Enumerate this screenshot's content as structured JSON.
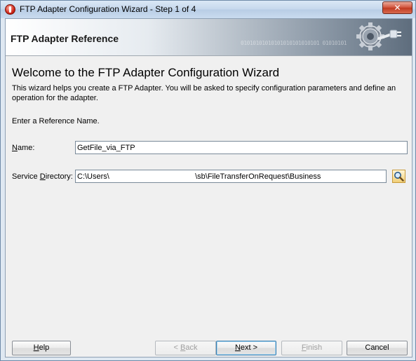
{
  "window": {
    "title": "FTP Adapter Configuration Wizard - Step 1 of 4",
    "close_label": "✕"
  },
  "banner": {
    "title": "FTP Adapter Reference",
    "binary_decoration": "01010101010101010101010101  01010101"
  },
  "main": {
    "welcome_title": "Welcome to the FTP Adapter Configuration Wizard",
    "welcome_desc": "This wizard helps you create a FTP Adapter. You will be asked to specify configuration parameters and define an operation for the adapter.",
    "prompt": "Enter a Reference Name.",
    "name_label_hotkey": "N",
    "name_label_rest": "ame:",
    "name_value": "GetFile_via_FTP",
    "service_dir_label_pre": "Service ",
    "service_dir_label_hotkey": "D",
    "service_dir_label_rest": "irectory:",
    "service_dir_value": "C:\\Users\\                                        \\sb\\FileTransferOnRequest\\Business"
  },
  "footer": {
    "help_hotkey": "H",
    "help_rest": "elp",
    "back_pre": "< ",
    "back_hotkey": "B",
    "back_rest": "ack",
    "next_hotkey": "N",
    "next_rest": "ext >",
    "finish_hotkey": "F",
    "finish_rest": "inish",
    "cancel_label": "Cancel"
  },
  "colors": {
    "title_bar": "#c5d7ec",
    "close_button": "#c13a21",
    "search_button": "#f1cf77"
  }
}
